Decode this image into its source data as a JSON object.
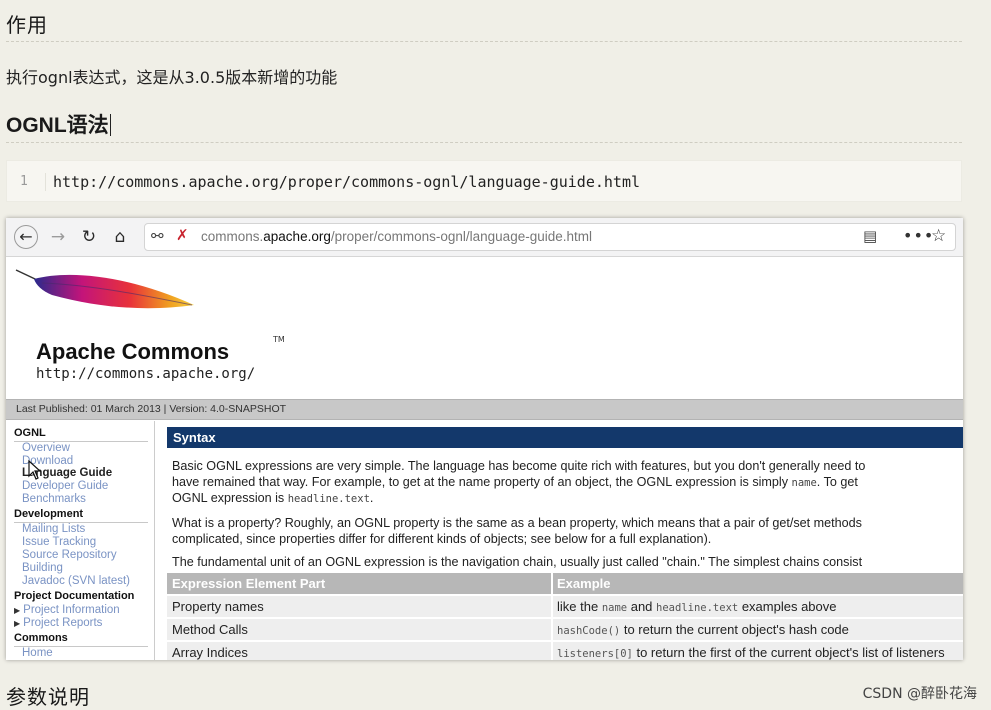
{
  "article": {
    "heading_purpose": "作用",
    "description": "执行ognl表达式，这是从3.0.5版本新增的功能",
    "heading_syntax": "OGNL语法",
    "code_line_number": "1",
    "code_text": "http://commons.apache.org/proper/commons-ognl/language-guide.html",
    "heading_params": "参数说明",
    "watermark": "CSDN @醉卧花海"
  },
  "browser": {
    "url_prefix": "commons.",
    "url_domain": "apache.org",
    "url_path": "/proper/commons-ognl/language-guide.html",
    "icons": {
      "back": "back-arrow-icon",
      "forward": "forward-arrow-icon",
      "reload": "reload-icon",
      "home": "home-icon",
      "shield": "shield-icon",
      "tracking": "tracking-protection-icon",
      "reader": "reader-view-icon",
      "more": "more-actions-icon",
      "bookmark": "bookmark-star-icon"
    }
  },
  "site": {
    "logo_title": "Apache Commons",
    "logo_tm": "TM",
    "logo_url": "http://commons.apache.org/",
    "published": "Last Published: 01 March 2013  |  Version: 4.0-SNAPSHOT"
  },
  "nav": {
    "ognl_heading": "OGNL",
    "ognl_items": [
      "Overview",
      "Download",
      "Language Guide",
      "Developer Guide",
      "Benchmarks"
    ],
    "development_heading": "Development",
    "development_items": [
      "Mailing Lists",
      "Issue Tracking",
      "Source Repository",
      "Building",
      "Javadoc (SVN latest)"
    ],
    "projdoc_heading": "Project Documentation",
    "projdoc_items": [
      "Project Information",
      "Project Reports"
    ],
    "commons_heading": "Commons",
    "commons_items": [
      "Home"
    ]
  },
  "content": {
    "section_title": "Syntax",
    "p1_line1": "Basic OGNL expressions are very simple. The language has become quite rich with features, but you don't generally need to",
    "p1_line2a": "have remained that way. For example, to get at the name property of an object, the OGNL expression is simply ",
    "p1_code1": "name",
    "p1_line2b": ". To get",
    "p1_line3a": "OGNL expression is ",
    "p1_code2": "headline.text",
    "p1_line3b": ".",
    "p2_line1": "What is a property? Roughly, an OGNL property is the same as a bean property, which means that a pair of get/set methods",
    "p2_line2": "complicated, since properties differ for different kinds of objects; see below for a full explanation).",
    "p3_line1": "The fundamental unit of an OGNL expression is the navigation chain, usually just called \"chain.\" The simplest chains consist",
    "table_headers": [
      "Expression Element Part",
      "Example"
    ],
    "table_rows": [
      {
        "part": "Property names",
        "ex_pre": "like the ",
        "ex_code1": "name",
        "ex_mid": " and ",
        "ex_code2": "headline.text",
        "ex_post": " examples above"
      },
      {
        "part": "Method Calls",
        "ex_code1": "hashCode()",
        "ex_post": " to return the current object's hash code"
      },
      {
        "part": "Array Indices",
        "ex_code1": "listeners[0]",
        "ex_post": " to return the first of the current object's list of listeners"
      }
    ]
  }
}
